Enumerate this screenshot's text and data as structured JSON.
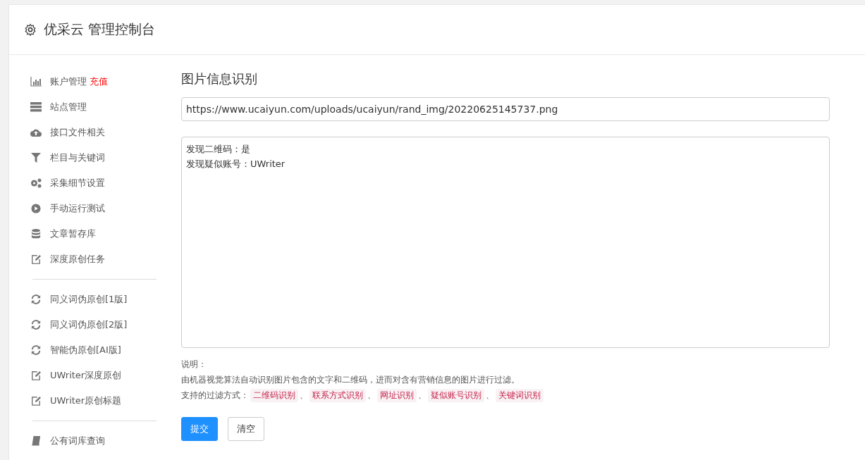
{
  "header": {
    "title": "优采云 管理控制台"
  },
  "sidebar": {
    "groups": [
      [
        {
          "label": "账户管理",
          "badge": "充值"
        },
        {
          "label": "站点管理"
        },
        {
          "label": "接口文件相关"
        },
        {
          "label": "栏目与关键词"
        },
        {
          "label": "采集细节设置"
        },
        {
          "label": "手动运行测试"
        },
        {
          "label": "文章暂存库"
        },
        {
          "label": "深度原创任务"
        }
      ],
      [
        {
          "label": "同义词伪原创[1版]"
        },
        {
          "label": "同义词伪原创[2版]"
        },
        {
          "label": "智能伪原创[AI版]"
        },
        {
          "label": "UWriter深度原创"
        },
        {
          "label": "UWriter原创标题"
        }
      ],
      [
        {
          "label": "公有词库查询"
        }
      ]
    ]
  },
  "main": {
    "title": "图片信息识别",
    "url_field": {
      "value": "https://www.ucaiyun.com/uploads/ucaiyun/rand_img/20220625145737.png"
    },
    "result_box": {
      "lines": [
        "发现二维码：是",
        "发现疑似账号：UWriter"
      ]
    },
    "notes": {
      "heading": "说明：",
      "description": "由机器视觉算法自动识别图片包含的文字和二维码，进而对含有营销信息的图片进行过滤。",
      "filters_label": "支持的过滤方式：",
      "separator": "、",
      "filters": [
        "二维码识别",
        "联系方式识别",
        "网址识别",
        "疑似账号识别",
        "关键词识别"
      ]
    },
    "buttons": [
      {
        "label": "提交",
        "kind": "primary"
      },
      {
        "label": "清空",
        "kind": "default"
      }
    ]
  }
}
